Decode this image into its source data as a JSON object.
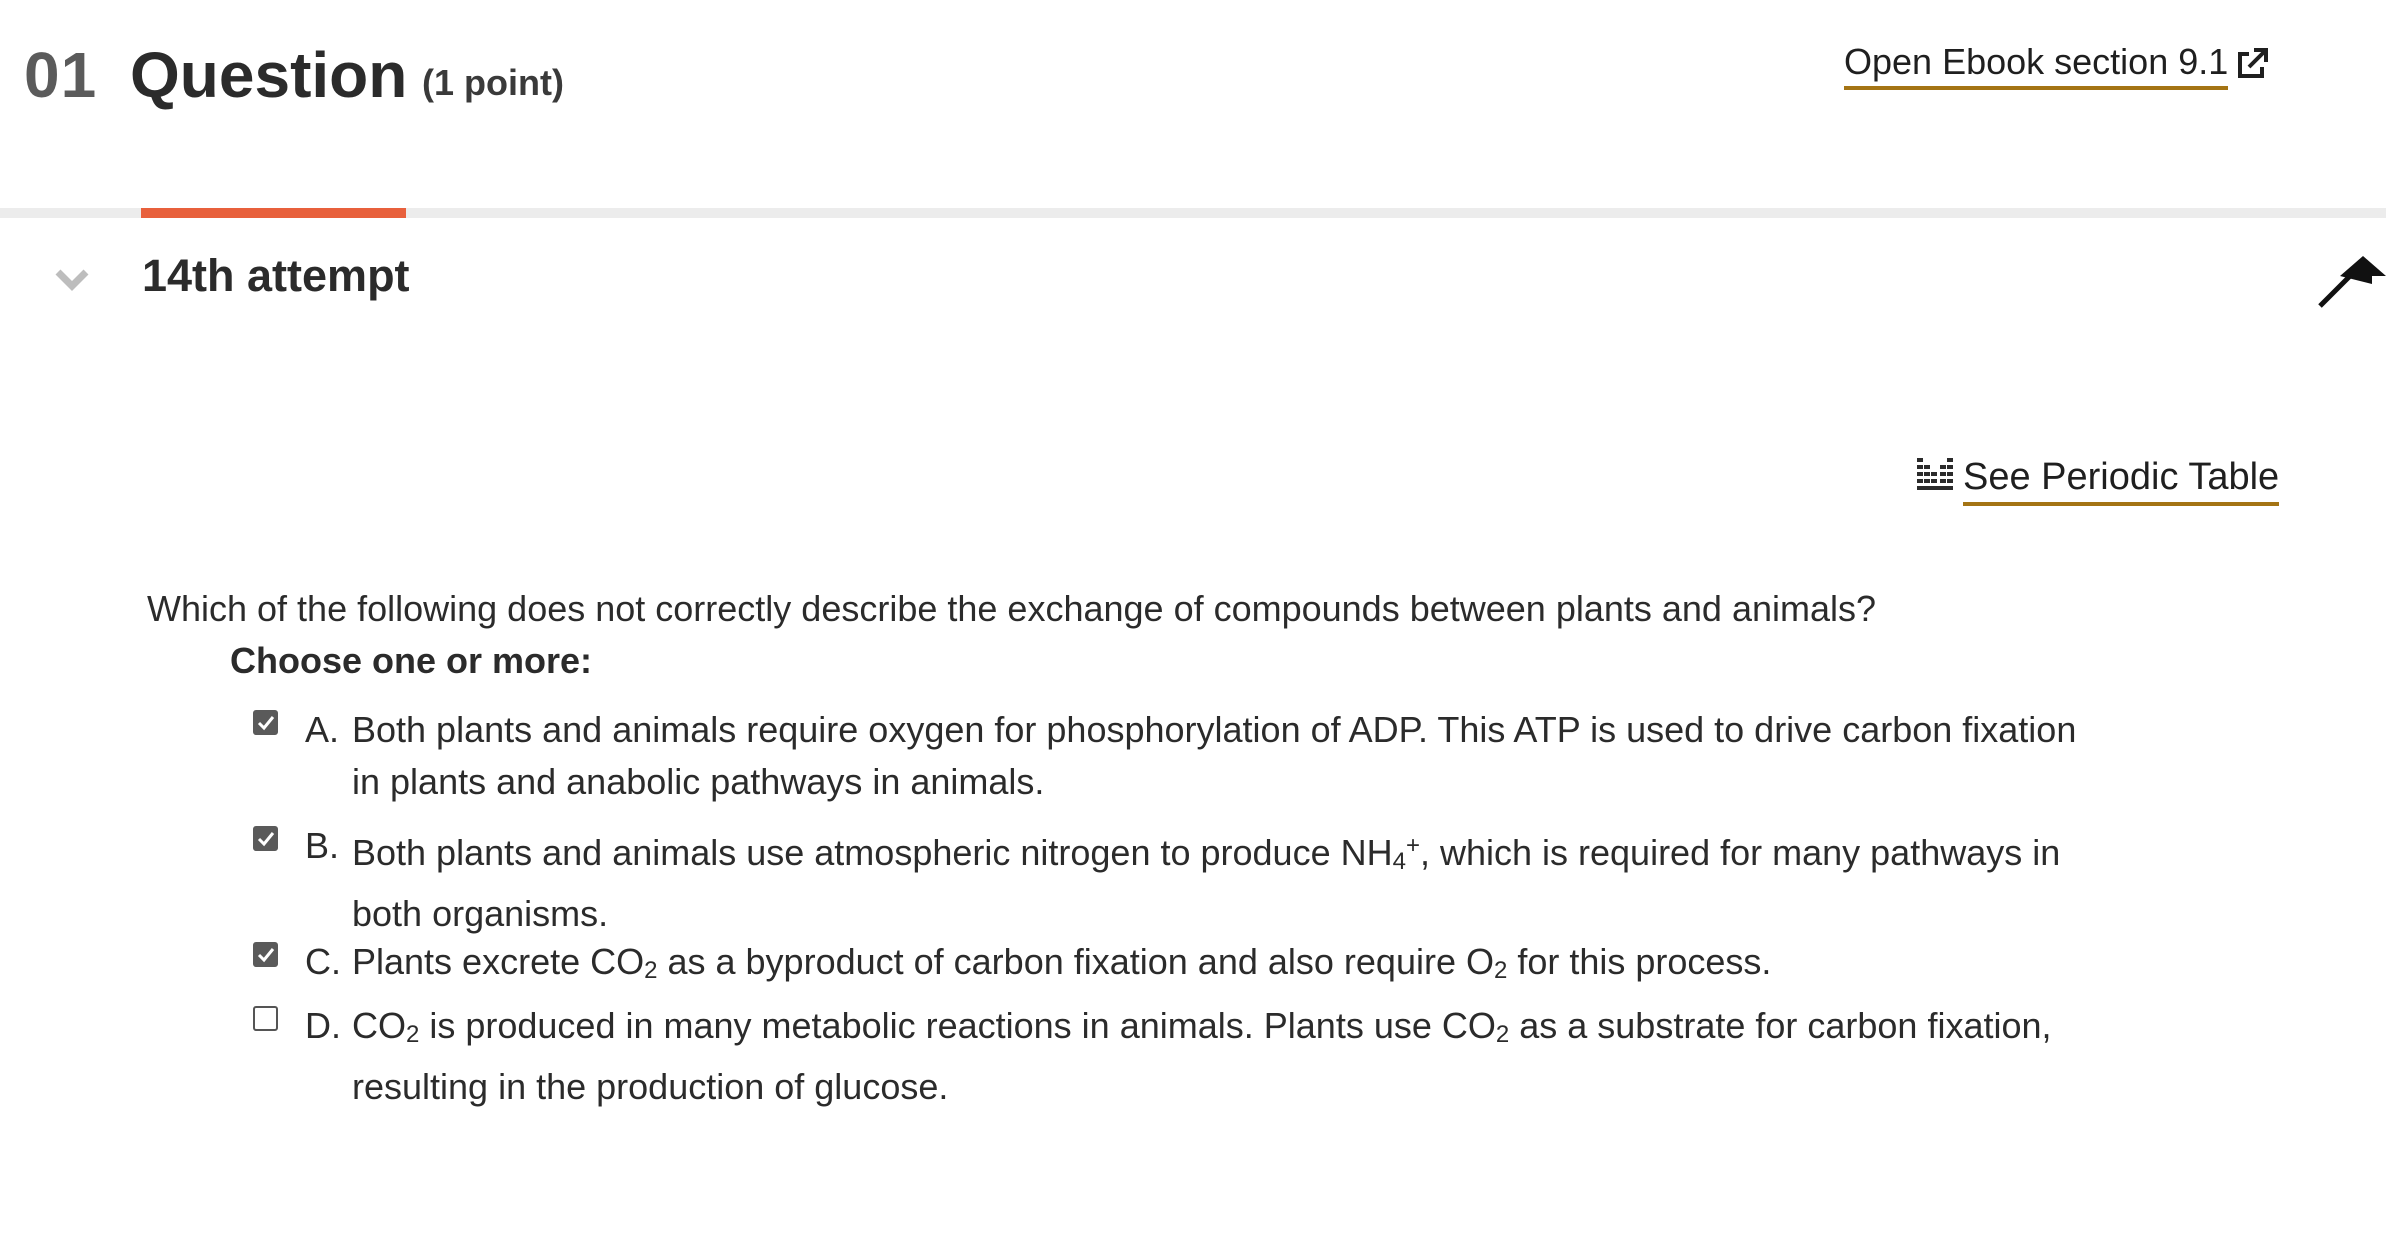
{
  "header": {
    "number": "01",
    "title": "Question",
    "points": "(1 point)",
    "ebook_link": "Open Ebook section 9.1"
  },
  "attempt": {
    "label": "14th attempt"
  },
  "tools": {
    "periodic_table": "See Periodic Table"
  },
  "question": {
    "text": "Which of the following does not correctly describe the exchange of compounds between plants and animals?",
    "instruction": "Choose one or more:",
    "options": [
      {
        "letter": "A.",
        "checked": true,
        "parts": {
          "p1": "Both plants and animals require oxygen for phosphorylation of ADP. This ATP is used to drive carbon fixation in plants and anabolic pathways in animals."
        }
      },
      {
        "letter": "B.",
        "checked": true,
        "parts": {
          "p1": "Both plants and animals use atmospheric nitrogen to produce NH",
          "sub1": "4",
          "sup1": "+",
          "p2": ", which is required for many pathways in both organisms."
        }
      },
      {
        "letter": "C.",
        "checked": true,
        "parts": {
          "p1": "Plants excrete CO",
          "sub1": "2",
          "p2": " as a byproduct of carbon fixation and also require O",
          "sub2": "2",
          "p3": " for this process."
        }
      },
      {
        "letter": "D.",
        "checked": false,
        "parts": {
          "p1": "CO",
          "sub1": "2",
          "p2": " is produced in many metabolic reactions in animals. Plants use CO",
          "sub2": "2",
          "p3": " as a substrate for carbon fixation, resulting in the production of glucose."
        }
      }
    ]
  }
}
